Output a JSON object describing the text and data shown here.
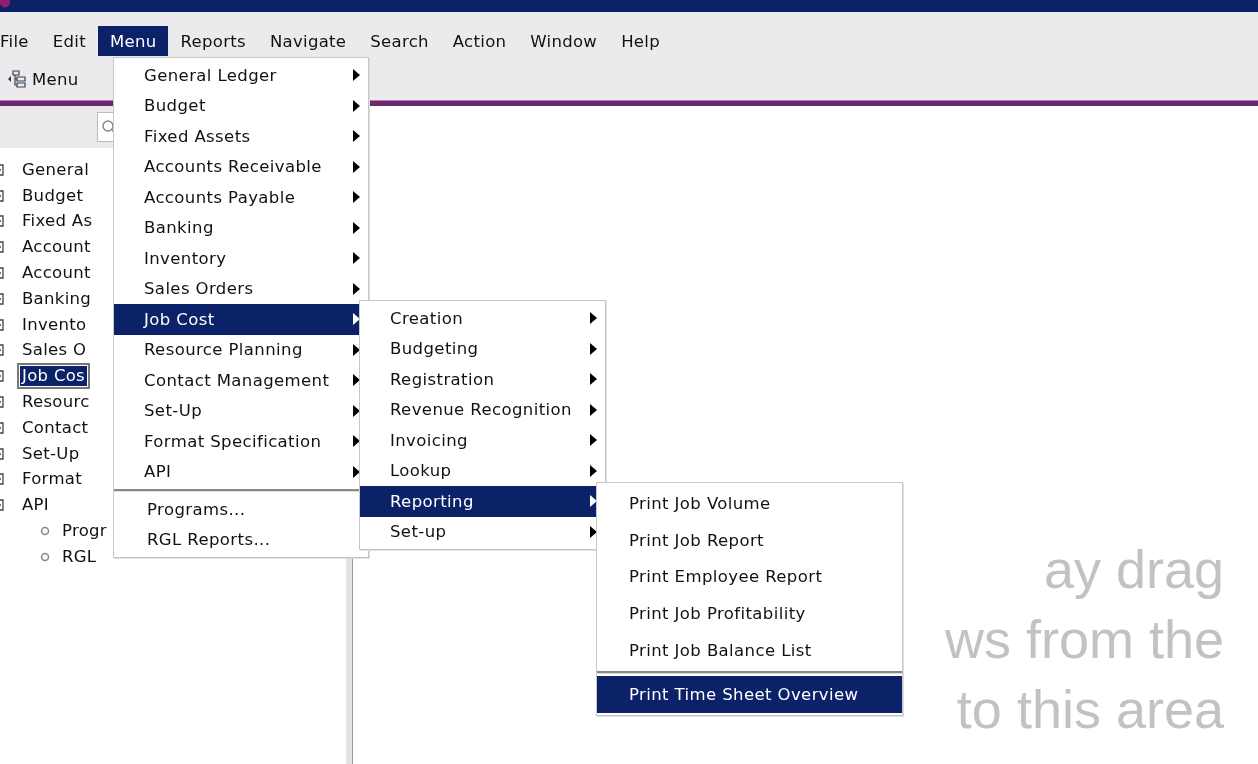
{
  "menubar": [
    {
      "label": "File",
      "selected": false
    },
    {
      "label": "Edit",
      "selected": false
    },
    {
      "label": "Menu",
      "selected": true
    },
    {
      "label": "Reports",
      "selected": false
    },
    {
      "label": "Navigate",
      "selected": false
    },
    {
      "label": "Search",
      "selected": false
    },
    {
      "label": "Action",
      "selected": false
    },
    {
      "label": "Window",
      "selected": false
    },
    {
      "label": "Help",
      "selected": false
    }
  ],
  "toolbar": {
    "menu_button": "Menu"
  },
  "sidebar": {
    "tree": [
      {
        "label": "General",
        "selected": false
      },
      {
        "label": "Budget",
        "selected": false
      },
      {
        "label": "Fixed As",
        "selected": false
      },
      {
        "label": "Account",
        "selected": false
      },
      {
        "label": "Account",
        "selected": false
      },
      {
        "label": "Banking",
        "selected": false
      },
      {
        "label": "Invento",
        "selected": false
      },
      {
        "label": "Sales O",
        "selected": false
      },
      {
        "label": "Job Cos",
        "selected": true
      },
      {
        "label": "Resourc",
        "selected": false
      },
      {
        "label": "Contact",
        "selected": false
      },
      {
        "label": "Set-Up",
        "selected": false
      },
      {
        "label": "Format",
        "selected": false
      },
      {
        "label": "API",
        "selected": false,
        "children": [
          {
            "label": "Progr",
            "selected": false
          },
          {
            "label": "RGL",
            "selected": false
          }
        ]
      }
    ]
  },
  "menus": [
    {
      "items": [
        {
          "label": "General Ledger",
          "kind": "submenu",
          "selected": false
        },
        {
          "label": "Budget",
          "kind": "submenu",
          "selected": false
        },
        {
          "label": "Fixed Assets",
          "kind": "submenu",
          "selected": false
        },
        {
          "label": "Accounts Receivable",
          "kind": "submenu",
          "selected": false
        },
        {
          "label": "Accounts Payable",
          "kind": "submenu",
          "selected": false
        },
        {
          "label": "Banking",
          "kind": "submenu",
          "selected": false
        },
        {
          "label": "Inventory",
          "kind": "submenu",
          "selected": false
        },
        {
          "label": "Sales Orders",
          "kind": "submenu",
          "selected": false
        },
        {
          "label": "Job Cost",
          "kind": "submenu",
          "selected": true
        },
        {
          "label": "Resource Planning",
          "kind": "submenu",
          "selected": false
        },
        {
          "label": "Contact Management",
          "kind": "submenu",
          "selected": false
        },
        {
          "label": "Set-Up",
          "kind": "submenu",
          "selected": false
        },
        {
          "label": "Format Specification",
          "kind": "submenu",
          "selected": false
        },
        {
          "label": "API",
          "kind": "submenu",
          "selected": false
        },
        {
          "label": "Programs...",
          "kind": "action",
          "selected": false,
          "separator_before": true
        },
        {
          "label": "RGL Reports...",
          "kind": "action",
          "selected": false
        }
      ]
    },
    {
      "items": [
        {
          "label": "Creation",
          "kind": "submenu",
          "selected": false
        },
        {
          "label": "Budgeting",
          "kind": "submenu",
          "selected": false
        },
        {
          "label": "Registration",
          "kind": "submenu",
          "selected": false
        },
        {
          "label": "Revenue Recognition",
          "kind": "submenu",
          "selected": false
        },
        {
          "label": "Invoicing",
          "kind": "submenu",
          "selected": false
        },
        {
          "label": "Lookup",
          "kind": "submenu",
          "selected": false
        },
        {
          "label": "Reporting",
          "kind": "submenu",
          "selected": true
        },
        {
          "label": "Set-up",
          "kind": "submenu",
          "selected": false
        }
      ]
    },
    {
      "items": [
        {
          "label": "Print Job Volume",
          "kind": "action",
          "selected": false
        },
        {
          "label": "Print Job Report",
          "kind": "action",
          "selected": false
        },
        {
          "label": "Print Employee Report",
          "kind": "action",
          "selected": false
        },
        {
          "label": "Print Job Profitability",
          "kind": "action",
          "selected": false
        },
        {
          "label": "Print Job Balance List",
          "kind": "action",
          "selected": false
        },
        {
          "label": "Print Time Sheet Overview",
          "kind": "action",
          "selected": true,
          "separator_before": true
        }
      ]
    }
  ],
  "hint_lines": [
    "ay drag",
    "ws from the",
    "to this area"
  ]
}
